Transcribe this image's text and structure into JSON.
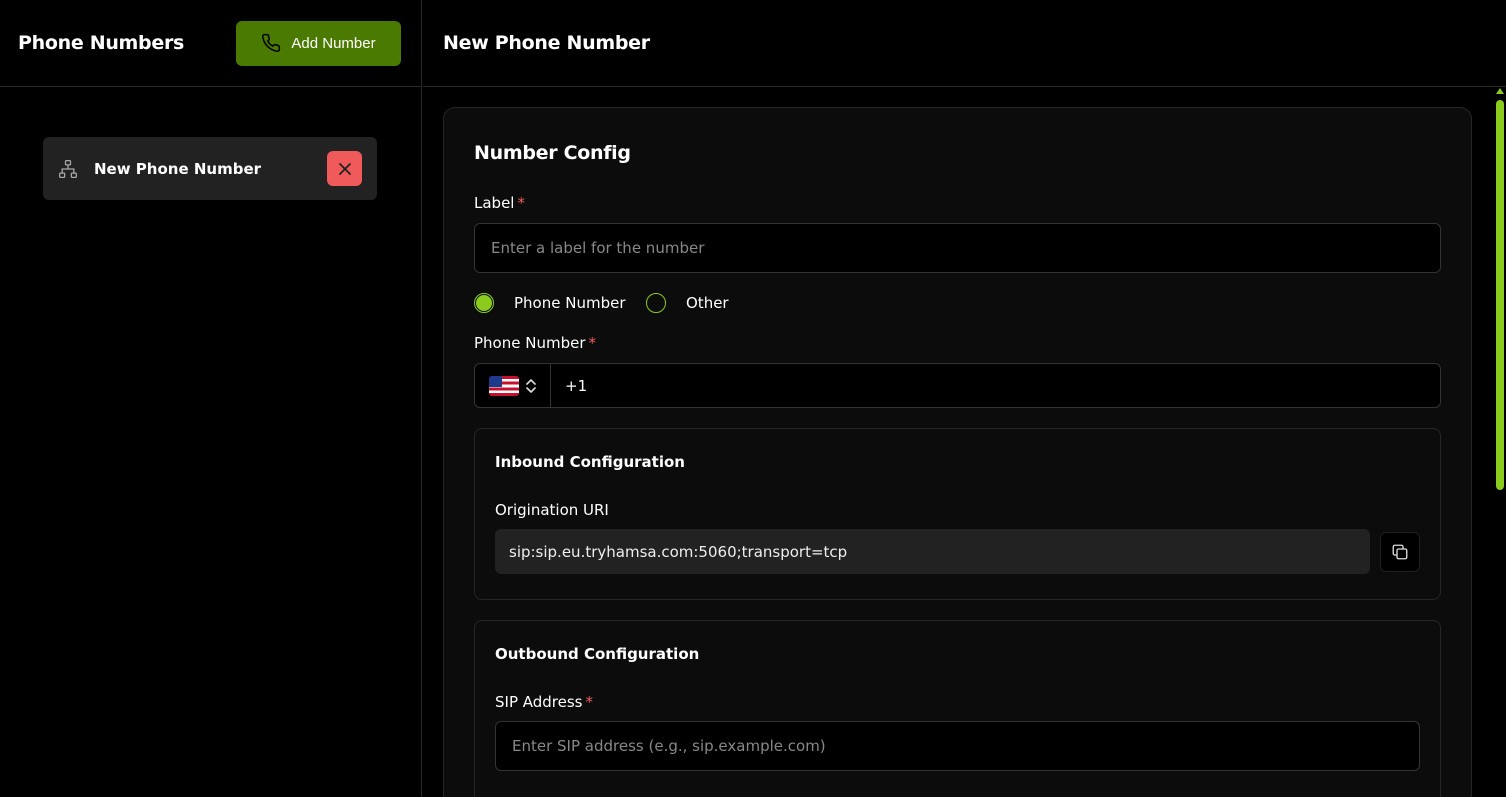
{
  "sidebar": {
    "title": "Phone Numbers",
    "add_button_label": "Add Number",
    "items": [
      {
        "label": "New Phone Number",
        "icon": "sitemap-icon"
      }
    ]
  },
  "main": {
    "title": "New Phone Number",
    "config": {
      "title": "Number Config",
      "label_field": {
        "label": "Label",
        "required_mark": "*",
        "value": "",
        "placeholder": "Enter a label for the number"
      },
      "type_options": [
        {
          "label": "Phone Number",
          "selected": true
        },
        {
          "label": "Other",
          "selected": false
        }
      ],
      "phone_field": {
        "label": "Phone Number",
        "required_mark": "*",
        "country": "US",
        "value": "+1"
      },
      "inbound": {
        "title": "Inbound Configuration",
        "uri_label": "Origination URI",
        "uri_value": "sip:sip.eu.tryhamsa.com:5060;transport=tcp"
      },
      "outbound": {
        "title": "Outbound Configuration",
        "sip_label": "SIP Address",
        "required_mark": "*",
        "sip_value": "",
        "sip_placeholder": "Enter SIP address (e.g., sip.example.com)"
      }
    }
  },
  "colors": {
    "accent": "#8acb1e",
    "add_button_bg": "#4a7a00",
    "danger": "#f05a5a"
  }
}
